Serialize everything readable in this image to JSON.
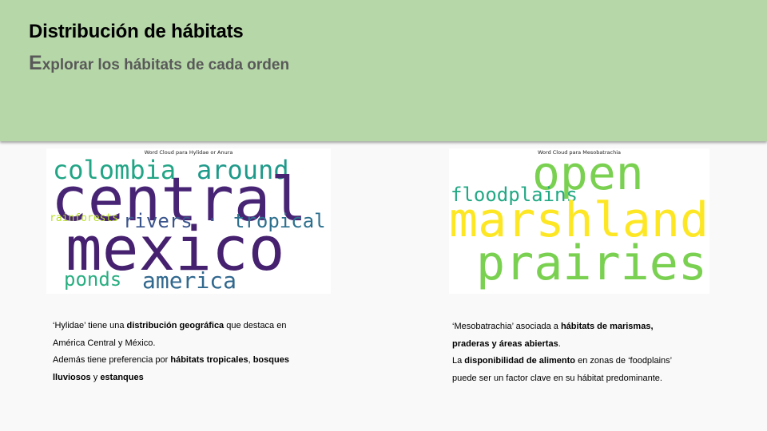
{
  "slide": {
    "title": "Distribución de hábitats",
    "subtitle_first": "E",
    "subtitle_rest": "xplorar los hábitats de cada orden",
    "header_color": "#b6d7a8"
  },
  "wordcloud_left": {
    "title": "Word Cloud para Hylidae or Anura",
    "words": {
      "colombia": "colombia",
      "around": "around",
      "central": "central",
      "rainforests": "rainforests",
      "rivers": "rivers",
      "dot": "·",
      "tropical": "tropical",
      "mexico": "mexico",
      "ponds": "ponds",
      "america": "america"
    }
  },
  "wordcloud_right": {
    "title": "Word Cloud para Mesobatrachia",
    "words": {
      "open": "open",
      "floodplains": "floodplains",
      "marshland": "marshland",
      "prairies": "prairies"
    }
  },
  "desc_left": {
    "l1a": "‘Hylidae’ tiene una ",
    "l1b": "distribución geográfica",
    "l1c": " que destaca en",
    "l2": "América Central y México.",
    "l3a": "Además tiene preferencia  por ",
    "l3b": "hábitats tropicales",
    "l3c": ", ",
    "l3d": "bosques",
    "l4a": "lluviosos",
    "l4b": " y ",
    "l4c": "estanques"
  },
  "desc_right": {
    "l1a": "‘Mesobatrachia’ asociada a  ",
    "l1b": "hábitats de marismas,",
    "l2a": "praderas  y  áreas  abiertas",
    "l2b": ".",
    "l3a": "La ",
    "l3b": "disponibilidad de alimento",
    "l3c": "  en zonas de ‘foodplains’",
    "l4": "puede ser un factor clave en su hábitat predominante."
  }
}
